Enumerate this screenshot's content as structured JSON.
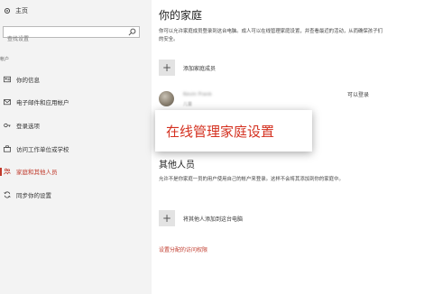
{
  "sidebar": {
    "home_label": "主页",
    "search_placeholder": "查找设置",
    "section_label": "帐户",
    "items": [
      {
        "label": "你的信息",
        "icon": "person-card-icon"
      },
      {
        "label": "电子邮件和应用帐户",
        "icon": "mail-icon"
      },
      {
        "label": "登录选项",
        "icon": "key-icon"
      },
      {
        "label": "访问工作单位或学校",
        "icon": "briefcase-icon"
      },
      {
        "label": "家庭和其他人员",
        "icon": "people-icon",
        "active": true
      },
      {
        "label": "同步你的设置",
        "icon": "sync-icon"
      }
    ]
  },
  "main": {
    "title": "你的家庭",
    "description": "你可以允许家庭成员登录到这台电脑。成人可以在线管理家庭设置，并查看最近的活动，从而确保孩子们的安全。",
    "add_family_label": "添加家庭成员",
    "member": {
      "name": "Kevin Frank",
      "role": "儿童",
      "status": "可以登录"
    },
    "manage_online_label": "在线管理家庭设置",
    "other_title": "其他人员",
    "other_description": "允许不是你家庭一员的用户使用自己的帐户来登录。这样不会将其添加到你的家庭中。",
    "add_other_label": "将其他人添加到这台电脑",
    "assigned_access_link": "设置分配的访问权限"
  },
  "colors": {
    "accent": "#c0392b",
    "sidebar_bg": "#f3f3f3",
    "callout_text": "#d4301f"
  }
}
